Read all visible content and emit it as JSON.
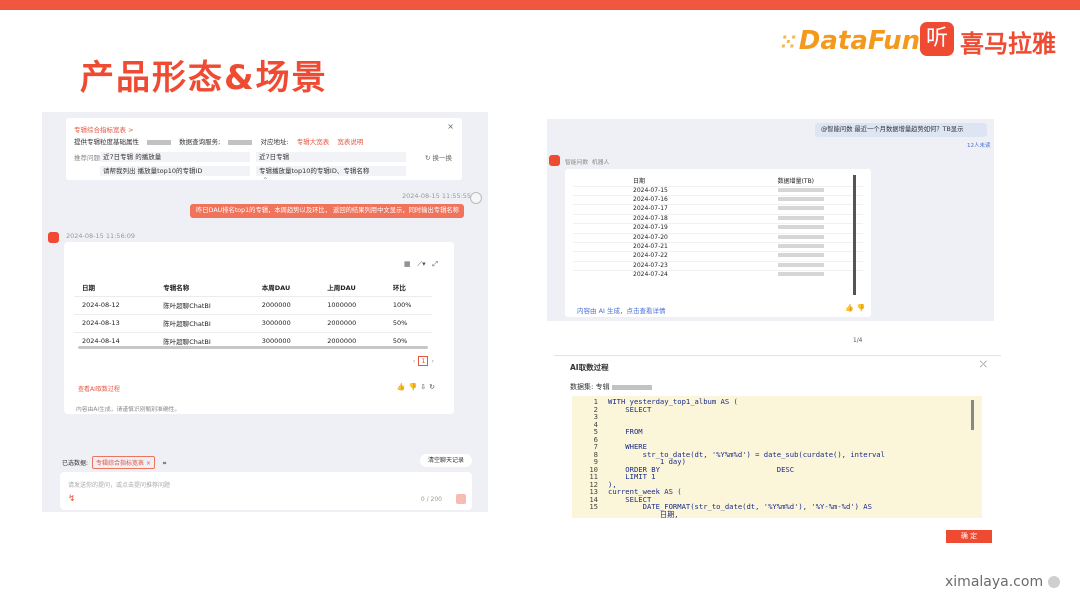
{
  "slide": {
    "title": "产品形态&场景",
    "logo_datafun": "DataFun.",
    "logo_xm_icon": "听",
    "logo_xm_text": "喜马拉雅",
    "footer": "ximalaya.com",
    "accent_color": "#ef4a32"
  },
  "panel1": {
    "prompt_header": "专辑综合指标宽表 >",
    "prompt_row1": [
      "提供专辑粒度基础属性",
      "数据查询服务;",
      "对应地址:",
      "专辑大宽表",
      "宽表说明"
    ],
    "questions_label": "推荐问题",
    "questions": [
      "近7日专辑 的播放量",
      "近7日专辑",
      "请帮我列出 播放量top10的专辑ID",
      "专辑播放量top10的专辑ID、专辑名称"
    ],
    "refresh_label": "换一换",
    "ts_user": "2024-08-15 11:55:55",
    "user_msg": "昨日DAU排名top1的专辑，本周趋势以及环比， 返回的结果列用中文显示，同时输出专辑名称",
    "ts_bot": "2024-08-15 11:56:09",
    "table": {
      "headers": [
        "日期",
        "专辑名称",
        "本周DAU",
        "上周DAU",
        "环比"
      ],
      "rows": [
        [
          "2024-08-12",
          "陈叶超聊ChatBI",
          "2000000",
          "1000000",
          "100%"
        ],
        [
          "2024-08-13",
          "陈叶超聊ChatBI",
          "3000000",
          "2000000",
          "50%"
        ],
        [
          "2024-08-14",
          "陈叶超聊ChatBI",
          "3000000",
          "2000000",
          "50%"
        ]
      ]
    },
    "page_current": "1",
    "card_foot": "查看AI取数过程",
    "disclaimer": "内容由AI生成，请谨慎识别甄别准确性。",
    "selected_label": "已选数据:",
    "selected_chip": "专辑综合指标宽表",
    "clear_label": "清空聊天记录",
    "input_placeholder": "请发送你的提问，或点击提问推荐问题",
    "input_count": "0 / 200"
  },
  "panel2": {
    "question": "@智能问数 最近一个月数据增量趋势如何？TB显示",
    "unread": "12人未读",
    "bot_name": "智能问数",
    "bot_tag": "机器人",
    "col_date": "日期",
    "col_value": "数据增量(TB)",
    "dates": [
      "2024-07-15",
      "2024-07-16",
      "2024-07-17",
      "2024-07-18",
      "2024-07-19",
      "2024-07-20",
      "2024-07-21",
      "2024-07-22",
      "2024-07-23",
      "2024-07-24"
    ],
    "pager": "1/4",
    "more_link": "内容由 AI 生成，点击查看详情"
  },
  "panel3": {
    "title": "AI取数过程",
    "dataset_label": "数据集:",
    "dataset_value": "专辑",
    "line_numbers": [
      "1",
      "2",
      "3",
      "4",
      "5",
      "6",
      "7",
      "8",
      "9",
      "10",
      "11",
      "12",
      "13",
      "14",
      "15"
    ],
    "code_lines": [
      "WITH yesterday_top1_album AS (",
      "    SELECT",
      "",
      "",
      "    FROM",
      "",
      "    WHERE",
      "        str_to_date(dt, '%Y%m%d') = date_sub(curdate(), interval",
      "            1 day)",
      "    ORDER BY                           DESC",
      "    LIMIT 1",
      "),",
      "current_week AS (",
      "    SELECT",
      "        DATE_FORMAT(str_to_date(dt, '%Y%m%d'), '%Y-%m-%d') AS",
      "            日期,"
    ],
    "ok_label": "确 定"
  }
}
